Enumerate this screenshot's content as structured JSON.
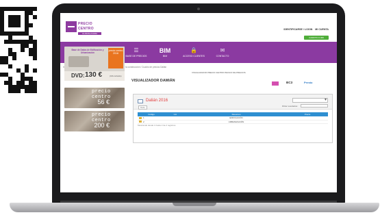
{
  "header": {
    "logo_line1": "PRECIO",
    "logo_line2": "CENTRO",
    "logo_tag": "GUADALAJARA",
    "login_links": [
      "IDENTIFICARSE / LOGIN",
      "MI CUENTA"
    ],
    "green_button": "CARRITO 0.00€"
  },
  "nav": {
    "items": [
      {
        "icon": "house-icon",
        "glyph": "⌂",
        "label": "QUÉ SOMOS"
      },
      {
        "icon": "cart-icon",
        "glyph": "🛒",
        "label": "PRODUCTOS"
      },
      {
        "icon": "database-icon",
        "glyph": "☰",
        "label": "BASE DE PRECIOS"
      },
      {
        "icon": "bim-icon",
        "glyph": "BIM",
        "label": "BIM"
      },
      {
        "icon": "lock-icon",
        "glyph": "🔒",
        "label": "ACCESO CLIENTES"
      },
      {
        "icon": "contact-icon",
        "glyph": "✉",
        "label": "CONTACTO"
      }
    ]
  },
  "breadcrumb": "Inicio / VISUALIZADORES POR BANCA / Cuadro de precios de la construcción / Cuadro de precios Dalián",
  "banners": {
    "b1_title": "Base de Datos de Edificación y Urbanización",
    "b1_badge": "precio centro 2016",
    "b1_dvd": "DVD:",
    "b1_price": "130 €",
    "b1_small": "(IVA incluido)",
    "b2_brand": "precio centro",
    "b2_price": "56 €",
    "b3_brand": "precio centro",
    "b3_price": "200 €"
  },
  "main": {
    "title": "VISUALIZADOR DAMIÁN",
    "top_note": "VISUALIZADOR PRECIO CENTRO BANCO DE PRECIOS",
    "bc3": "BC3",
    "presto": "Presto"
  },
  "viewer": {
    "title": "Dalián 2016",
    "search_label": "Filtrar resultados:",
    "all_label": "Todo",
    "columns": [
      "Código",
      "Ud.",
      "Resumen",
      "Precio"
    ],
    "rows": [
      [
        "1",
        "",
        "EDIFICACIÓN",
        ""
      ],
      [
        "2",
        "",
        "URBANIZACIÓN",
        ""
      ]
    ],
    "footer": "Mostrando desde 1 hasta 2 de 2 registros"
  },
  "colors": {
    "brand_purple": "#8b3aa1",
    "accent_blue": "#2e8fd1",
    "title_red": "#e23b3b",
    "green": "#4fae3a"
  }
}
